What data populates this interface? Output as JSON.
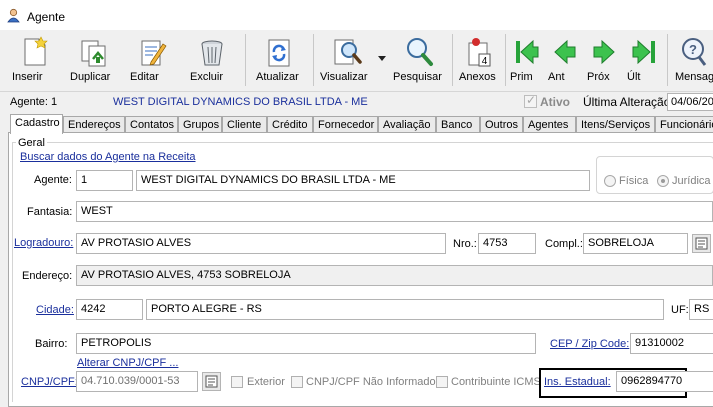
{
  "window": {
    "title": "Agente",
    "icon": "agent-app-icon"
  },
  "toolbar": {
    "buttons": [
      {
        "label": "Inserir",
        "icon": "new-document-icon"
      },
      {
        "label": "Duplicar",
        "icon": "duplicate-icon"
      },
      {
        "label": "Editar",
        "icon": "edit-pencil-icon"
      },
      {
        "label": "Excluir",
        "icon": "trash-icon"
      },
      {
        "label": "Atualizar",
        "icon": "refresh-icon"
      },
      {
        "label": "Visualizar",
        "icon": "view-magnifier-icon"
      },
      {
        "label": "Pesquisar",
        "icon": "search-icon"
      },
      {
        "label": "Anexos",
        "icon": "attachments-icon",
        "badge": "4"
      },
      {
        "label": "Prim",
        "icon": "first-record-icon"
      },
      {
        "label": "Ant",
        "icon": "previous-record-icon"
      },
      {
        "label": "Próx",
        "icon": "next-record-icon"
      },
      {
        "label": "Últ",
        "icon": "last-record-icon"
      },
      {
        "label": "Mensag",
        "icon": "message-icon"
      }
    ]
  },
  "header": {
    "agent_label": "Agente: 1",
    "agent_name": "WEST DIGITAL DYNAMICS DO BRASIL LTDA - ME",
    "ativo_label": "Ativo",
    "ativo_checked": true,
    "ultima_alteracao_label": "Última Alteração:",
    "ultima_alteracao_value": "04/06/20"
  },
  "tabs": [
    "Cadastro",
    "Endereços",
    "Contatos",
    "Grupos",
    "Cliente",
    "Crédito",
    "Fornecedor",
    "Avaliação",
    "Banco",
    "Outros",
    "Agentes",
    "Itens/Serviços",
    "Funcionário"
  ],
  "active_tab": "Cadastro",
  "form": {
    "group_title": "Geral",
    "buscar_link": "Buscar dados do Agente na Receita",
    "agente_label": "Agente:",
    "agente_code": "1",
    "agente_name": "WEST DIGITAL DYNAMICS DO BRASIL LTDA - ME",
    "pessoa": {
      "fisica_label": "Física",
      "juridica_label": "Jurídica",
      "selected": "Jurídica"
    },
    "fantasia_label": "Fantasia:",
    "fantasia_value": "WEST",
    "logradouro_label": "Logradouro:",
    "logradouro_value": "AV PROTASIO ALVES",
    "nro_label": "Nro.:",
    "nro_value": "4753",
    "compl_label": "Compl.:",
    "compl_value": "SOBRELOJA",
    "endereco_label": "Endereço:",
    "endereco_value": "AV PROTASIO ALVES, 4753 SOBRELOJA",
    "cidade_label": "Cidade:",
    "cidade_code": "4242",
    "cidade_name": "PORTO ALEGRE - RS",
    "uf_label": "UF:",
    "uf_value": "RS",
    "bairro_label": "Bairro:",
    "bairro_value": "PETROPOLIS",
    "cep_label": "CEP / Zip Code:",
    "cep_value": "91310002",
    "alterar_link": "Alterar CNPJ/CPF ...",
    "cnpj_label": "CNPJ/CPF:",
    "cnpj_value": "04.710.039/0001-53",
    "exterior_label": "Exterior",
    "cnpj_nao_informado_label": "CNPJ/CPF Não Informado",
    "contribuinte_icms_label": "Contribuinte ICMS",
    "ins_estadual_label": "Ins. Estadual:",
    "ins_estadual_value": "0962894770"
  }
}
